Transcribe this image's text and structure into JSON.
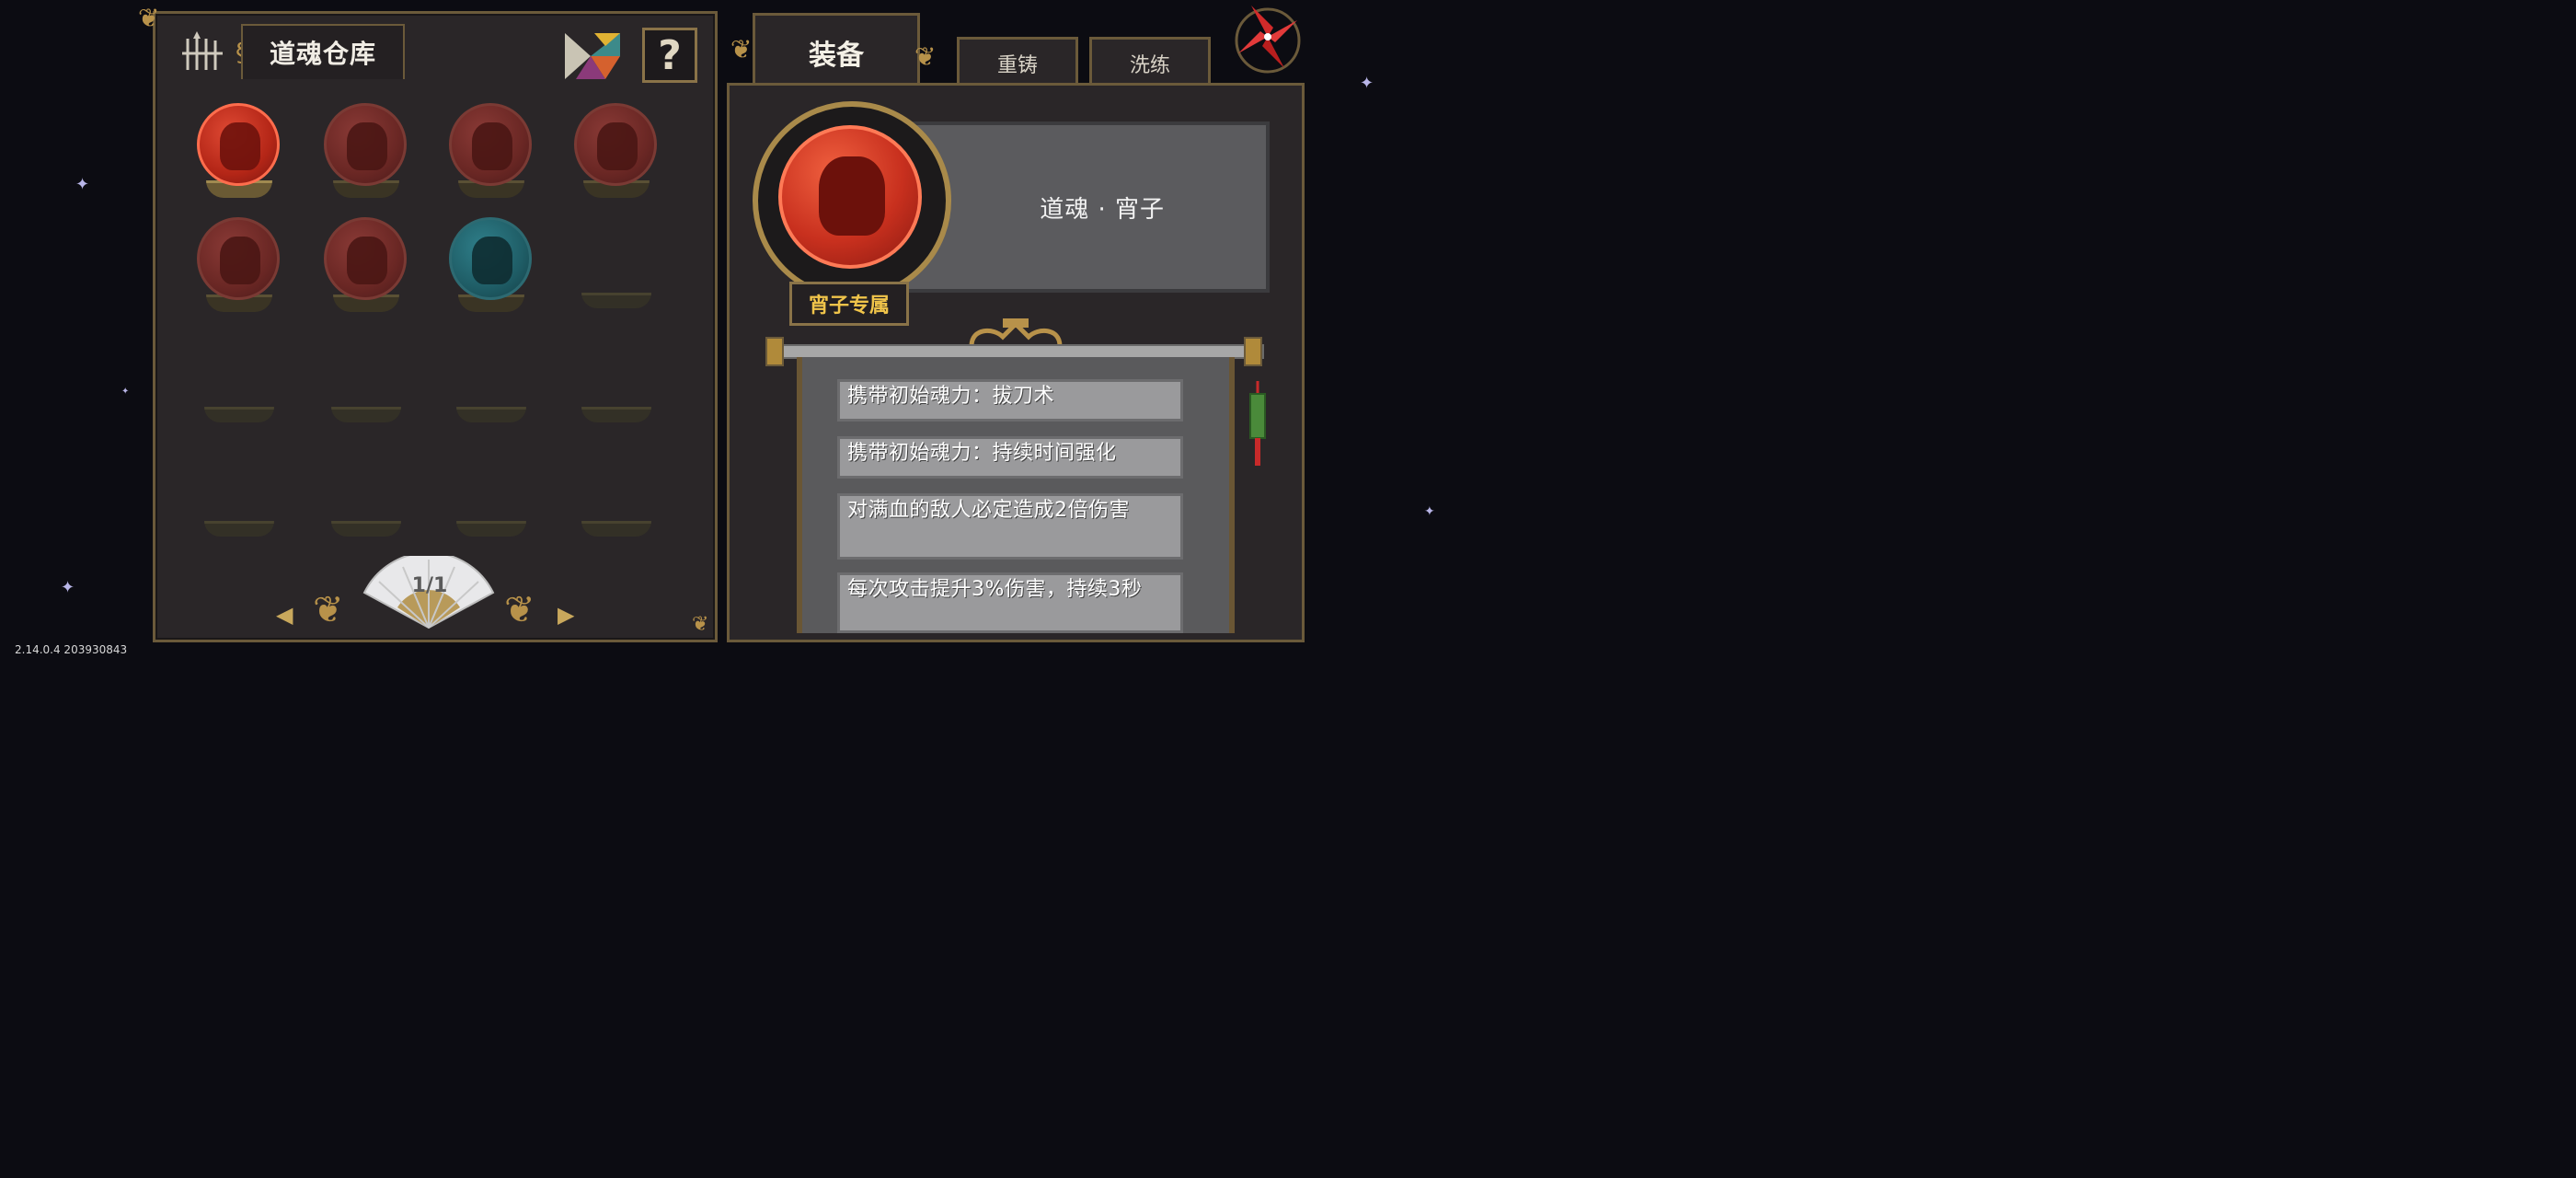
{
  "version": "2.14.0.4 203930843",
  "warehouse": {
    "title": "道魂仓库",
    "help_label": "?",
    "page_indicator": "1/1",
    "slots": [
      {
        "state": "red-bright"
      },
      {
        "state": "red-dim"
      },
      {
        "state": "red-dim"
      },
      {
        "state": "red-dim"
      },
      {
        "state": "red-dim"
      },
      {
        "state": "red-dim"
      },
      {
        "state": "teal"
      },
      {
        "state": "empty"
      },
      {
        "state": "empty"
      },
      {
        "state": "empty"
      },
      {
        "state": "empty"
      },
      {
        "state": "empty"
      },
      {
        "state": "empty"
      },
      {
        "state": "empty"
      },
      {
        "state": "empty"
      },
      {
        "state": "empty"
      }
    ]
  },
  "tabs": {
    "equip": "装备",
    "recast": "重铸",
    "refine": "洗练"
  },
  "detail": {
    "name": "道魂 · 宵子",
    "exclusive": "宵子专属",
    "effects": [
      "携带初始魂力：拔刀术",
      "携带初始魂力：持续时间强化",
      "对满血的敌人必定造成2倍伤害",
      "每次攻击提升3%伤害，持续3秒"
    ]
  },
  "colors": {
    "frame_gold": "#6b5a3a",
    "exclusive_text": "#f0c44a",
    "orb_red": "#c8301e",
    "orb_teal": "#1f5d66"
  }
}
